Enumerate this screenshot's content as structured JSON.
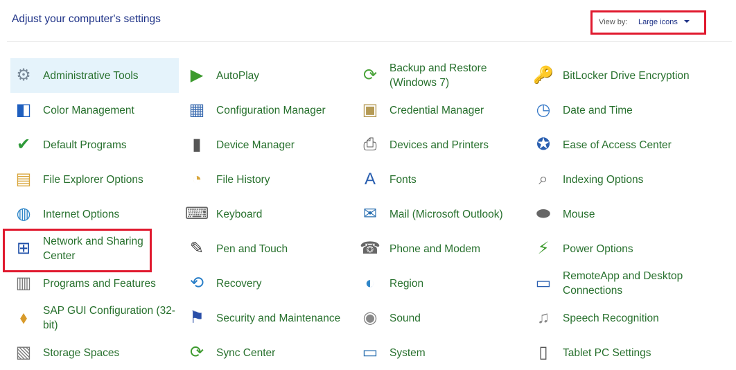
{
  "header": {
    "title": "Adjust your computer's settings"
  },
  "view_by": {
    "label": "View by:",
    "value": "Large icons"
  },
  "items": [
    {
      "label": "Administrative Tools",
      "icon": "⚙",
      "icon_name": "administrative-tools-icon",
      "color": "#7a8a99"
    },
    {
      "label": "AutoPlay",
      "icon": "▶",
      "icon_name": "autoplay-icon",
      "color": "#3d9a2e"
    },
    {
      "label": "Backup and Restore (Windows 7)",
      "icon": "⟳",
      "icon_name": "backup-restore-icon",
      "color": "#4aa33a"
    },
    {
      "label": "BitLocker Drive Encryption",
      "icon": "🔑",
      "icon_name": "bitlocker-icon",
      "color": "#9a7a2e"
    },
    {
      "label": "Color Management",
      "icon": "◧",
      "icon_name": "color-management-icon",
      "color": "#1f5fbf"
    },
    {
      "label": "Configuration Manager",
      "icon": "▦",
      "icon_name": "configuration-manager-icon",
      "color": "#3a6bb0"
    },
    {
      "label": "Credential Manager",
      "icon": "▣",
      "icon_name": "credential-manager-icon",
      "color": "#b59a55"
    },
    {
      "label": "Date and Time",
      "icon": "◷",
      "icon_name": "date-time-icon",
      "color": "#3a7bc8"
    },
    {
      "label": "Default Programs",
      "icon": "✔",
      "icon_name": "default-programs-icon",
      "color": "#2f9a3a"
    },
    {
      "label": "Device Manager",
      "icon": "▮",
      "icon_name": "device-manager-icon",
      "color": "#555555"
    },
    {
      "label": "Devices and Printers",
      "icon": "⎙",
      "icon_name": "devices-printers-icon",
      "color": "#555555"
    },
    {
      "label": "Ease of Access Center",
      "icon": "✪",
      "icon_name": "ease-of-access-icon",
      "color": "#2a5fb0"
    },
    {
      "label": "File Explorer Options",
      "icon": "▤",
      "icon_name": "file-explorer-options-icon",
      "color": "#d8a53a"
    },
    {
      "label": "File History",
      "icon": "◔",
      "icon_name": "file-history-icon",
      "color": "#d8a53a"
    },
    {
      "label": "Fonts",
      "icon": "A",
      "icon_name": "fonts-icon",
      "color": "#2a5fb0"
    },
    {
      "label": "Indexing Options",
      "icon": "⌕",
      "icon_name": "indexing-options-icon",
      "color": "#777777"
    },
    {
      "label": "Internet Options",
      "icon": "◍",
      "icon_name": "internet-options-icon",
      "color": "#2f86c8"
    },
    {
      "label": "Keyboard",
      "icon": "⌨",
      "icon_name": "keyboard-icon",
      "color": "#666666"
    },
    {
      "label": "Mail (Microsoft Outlook)",
      "icon": "✉",
      "icon_name": "mail-icon",
      "color": "#2a6fb0"
    },
    {
      "label": "Mouse",
      "icon": "⬬",
      "icon_name": "mouse-icon",
      "color": "#666666"
    },
    {
      "label": "Network and Sharing Center",
      "icon": "⊞",
      "icon_name": "network-sharing-icon",
      "color": "#1f4fa8"
    },
    {
      "label": "Pen and Touch",
      "icon": "✎",
      "icon_name": "pen-touch-icon",
      "color": "#444444"
    },
    {
      "label": "Phone and Modem",
      "icon": "☎",
      "icon_name": "phone-modem-icon",
      "color": "#666666"
    },
    {
      "label": "Power Options",
      "icon": "⚡",
      "icon_name": "power-options-icon",
      "color": "#3d9a2e"
    },
    {
      "label": "Programs and Features",
      "icon": "▥",
      "icon_name": "programs-features-icon",
      "color": "#777777"
    },
    {
      "label": "Recovery",
      "icon": "⟲",
      "icon_name": "recovery-icon",
      "color": "#2a7fc8"
    },
    {
      "label": "Region",
      "icon": "◐",
      "icon_name": "region-icon",
      "color": "#2f86c8"
    },
    {
      "label": "RemoteApp and Desktop Connections",
      "icon": "▭",
      "icon_name": "remoteapp-icon",
      "color": "#2a5fb0"
    },
    {
      "label": "SAP GUI Configuration (32-bit)",
      "icon": "⬧",
      "icon_name": "sap-gui-icon",
      "color": "#d89a2a"
    },
    {
      "label": "Security and Maintenance",
      "icon": "⚑",
      "icon_name": "security-maintenance-icon",
      "color": "#2a4fa8"
    },
    {
      "label": "Sound",
      "icon": "◉",
      "icon_name": "sound-icon",
      "color": "#888888"
    },
    {
      "label": "Speech Recognition",
      "icon": "♫",
      "icon_name": "speech-recognition-icon",
      "color": "#888888"
    },
    {
      "label": "Storage Spaces",
      "icon": "▧",
      "icon_name": "storage-spaces-icon",
      "color": "#777777"
    },
    {
      "label": "Sync Center",
      "icon": "⟳",
      "icon_name": "sync-center-icon",
      "color": "#3d9a2e"
    },
    {
      "label": "System",
      "icon": "▭",
      "icon_name": "system-icon",
      "color": "#2a6fb0"
    },
    {
      "label": "Tablet PC Settings",
      "icon": "▯",
      "icon_name": "tablet-pc-icon",
      "color": "#555555"
    }
  ],
  "selected_item": "Administrative Tools",
  "colors": {
    "link": "#27702d",
    "header": "#1e3287",
    "highlight": "#e0192e",
    "selection": "#e5f3fb"
  }
}
